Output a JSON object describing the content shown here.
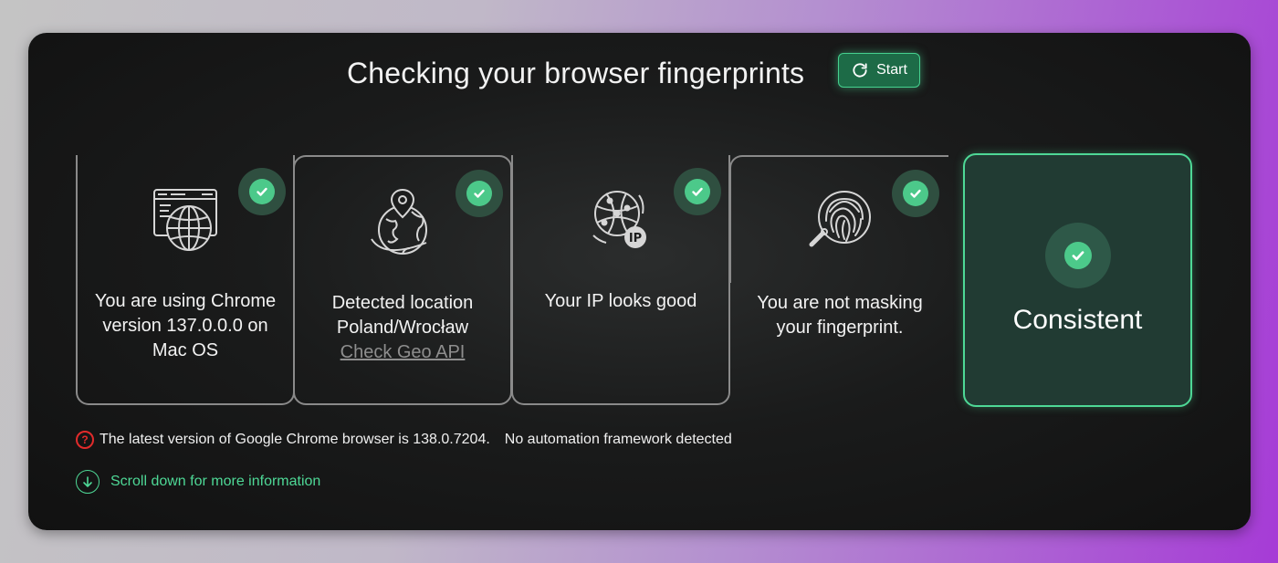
{
  "header": {
    "title": "Checking your browser fingerprints",
    "start_label": "Start"
  },
  "cards": [
    {
      "id": "browser",
      "icon": "browser-globe-icon",
      "text": "You are using Chrome version 137.0.0.0 on Mac OS",
      "status": "ok"
    },
    {
      "id": "location",
      "icon": "globe-pin-icon",
      "text": "Detected location Poland/Wrocław",
      "link": "Check Geo API",
      "status": "ok"
    },
    {
      "id": "ip",
      "icon": "ip-globe-icon",
      "text": "Your IP looks good",
      "status": "ok"
    },
    {
      "id": "fingerprint",
      "icon": "fingerprint-magnifier-icon",
      "text": "You are not masking your fingerprint.",
      "status": "ok"
    }
  ],
  "result": {
    "label": "Consistent",
    "icon": "check-circle-icon"
  },
  "notices": {
    "version": "The latest version of Google Chrome browser is 138.0.7204.",
    "automation": "No automation framework detected"
  },
  "scroll": {
    "label": "Scroll down for more information"
  },
  "colors": {
    "accent": "#4ed896",
    "result_bg": "#213b33",
    "error": "#e12b2b",
    "button_bg": "#1d6b47"
  }
}
